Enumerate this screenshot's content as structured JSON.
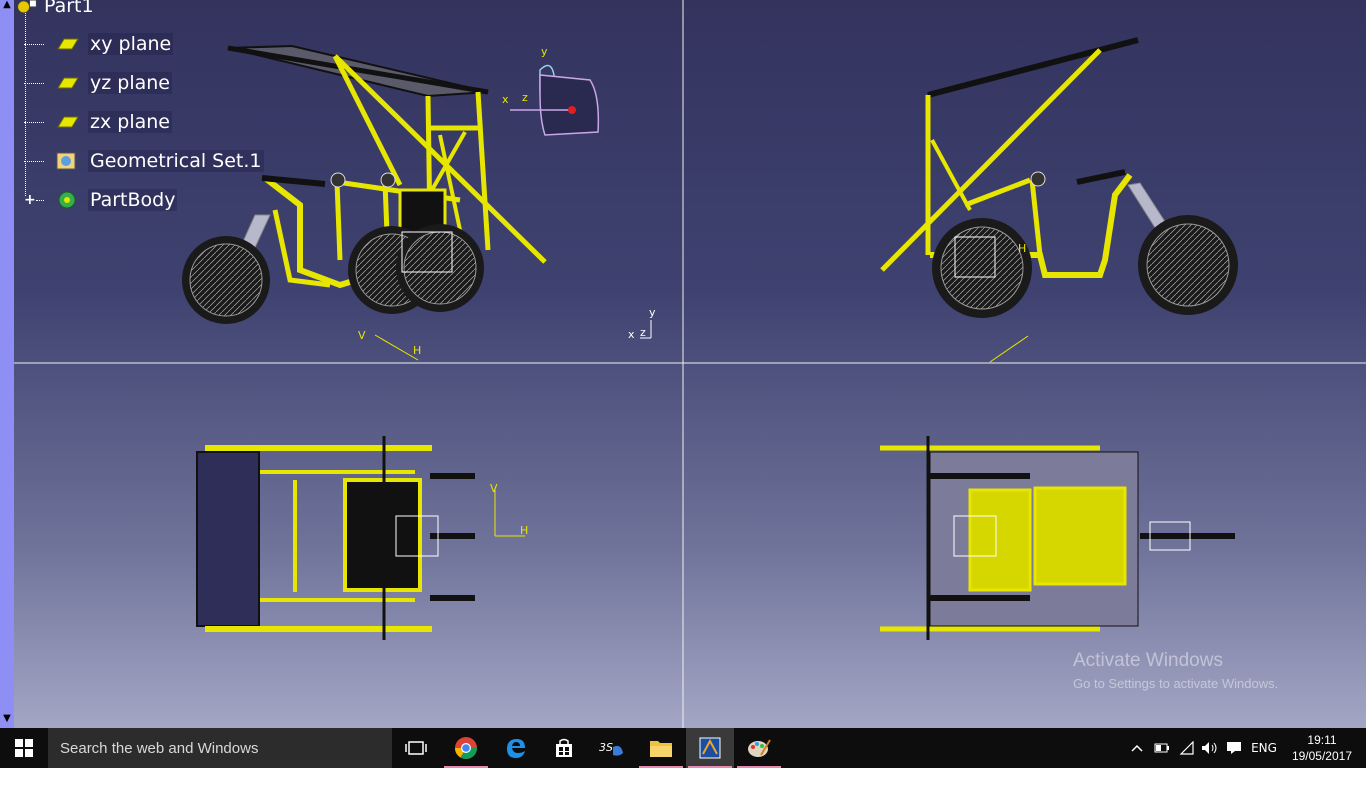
{
  "tree": {
    "root": "Part1",
    "items": [
      {
        "label": "xy plane",
        "icon": "plane-icon"
      },
      {
        "label": "yz plane",
        "icon": "plane-icon"
      },
      {
        "label": "zx plane",
        "icon": "plane-icon"
      },
      {
        "label": "Geometrical Set.1",
        "icon": "geometrical-set-icon"
      },
      {
        "label": "PartBody",
        "icon": "part-body-icon"
      }
    ]
  },
  "axes": {
    "top_left": {
      "y": "y",
      "x": "x",
      "z": "z",
      "v": "V",
      "h": "H"
    },
    "top_left_small": {
      "y": "y",
      "x": "x",
      "z": "z"
    },
    "top_right": {
      "h": "H"
    },
    "bottom_left": {
      "v": "V",
      "h": "H"
    }
  },
  "watermark": {
    "title": "Activate Windows",
    "subtitle": "Go to Settings to activate Windows."
  },
  "taskbar": {
    "search_placeholder": "Search the web and Windows",
    "apps": [
      "task-view-icon",
      "chrome-icon",
      "edge-icon",
      "store-icon",
      "catia-3ds-icon",
      "file-explorer-icon",
      "catia-app-icon",
      "paint-icon"
    ],
    "tray": {
      "language": "ENG",
      "time": "19:11",
      "date": "19/05/2017"
    }
  },
  "colors": {
    "viewport_top": "#33335e",
    "viewport_bottom": "#a3a6c4",
    "frame_yellow": "#e6e600",
    "tree_scrollbar": "#8e8ef4",
    "taskbar": "#0d0d0d"
  }
}
